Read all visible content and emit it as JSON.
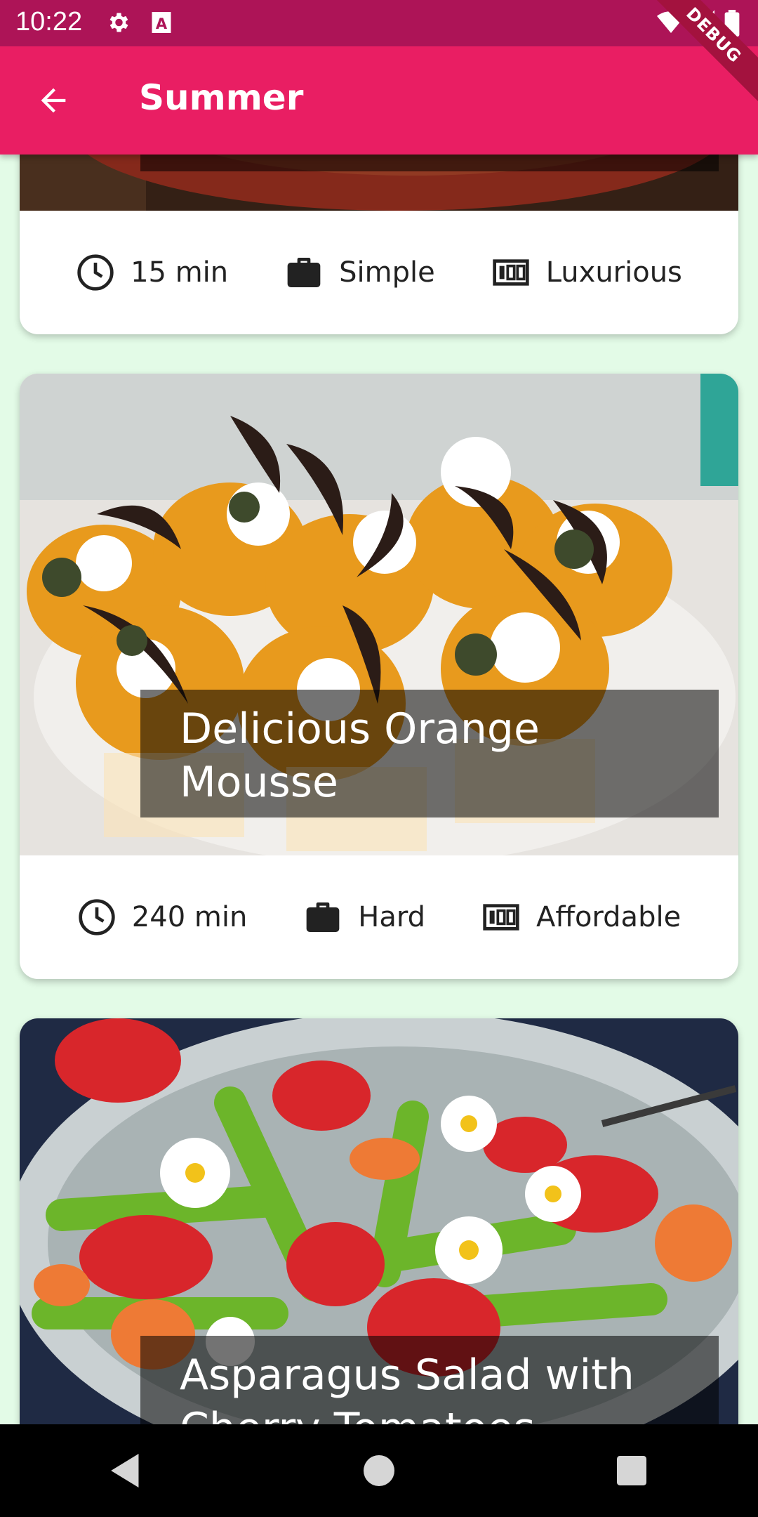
{
  "status_bar": {
    "time": "10:22",
    "icons": [
      "gear-icon",
      "a-icon",
      "wifi-icon",
      "signal-icon",
      "battery-icon"
    ],
    "debug_label": "DEBUG"
  },
  "app_bar": {
    "title": "Summer",
    "back_icon": "arrow-back-icon",
    "color": "#e91e63"
  },
  "meals": [
    {
      "title": "",
      "duration": "15 min",
      "complexity": "Simple",
      "affordability": "Luxurious"
    },
    {
      "title": "Delicious Orange Mousse",
      "duration": "240 min",
      "complexity": "Hard",
      "affordability": "Affordable"
    },
    {
      "title": "Asparagus Salad with Cherry Tomatoes",
      "duration": "",
      "complexity": "",
      "affordability": ""
    }
  ],
  "icons": {
    "duration": "clock-icon",
    "complexity": "briefcase-icon",
    "affordability": "money-icon"
  },
  "nav_bar": {
    "buttons": [
      "back-triangle-icon",
      "home-circle-icon",
      "recents-square-icon"
    ]
  }
}
